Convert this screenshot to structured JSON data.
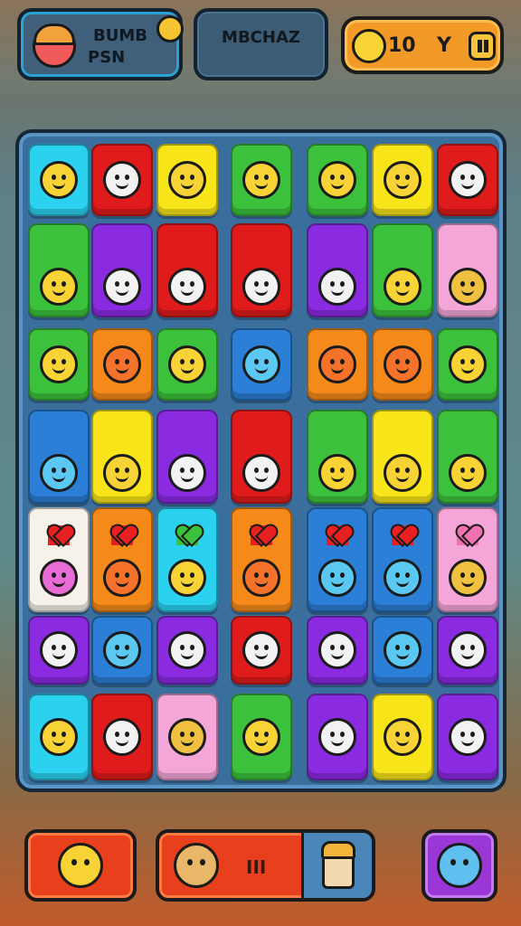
{
  "hud": {
    "player_name_line1": "BUMB",
    "player_name_line2": "PSN",
    "level_label": "MBCHAZ",
    "coin_value": "10",
    "coin_suffix": "Y",
    "pause_icon": "pause-icon"
  },
  "board": {
    "rows": 7,
    "cols": 7,
    "tiles": [
      [
        "cyan",
        "red",
        "yellow",
        "green",
        "green",
        "yellow",
        "red"
      ],
      [
        "green",
        "purple",
        "red",
        "red",
        "purple",
        "green",
        "pink"
      ],
      [
        "green",
        "orange",
        "green",
        "blue",
        "orange",
        "orange",
        "green"
      ],
      [
        "blue",
        "yellow",
        "purple",
        "red",
        "green",
        "yellow",
        "green"
      ],
      [
        "white",
        "orange",
        "cyan",
        "orange",
        "blue",
        "blue",
        "pink"
      ],
      [
        "purple",
        "blue",
        "purple",
        "red",
        "purple",
        "blue",
        "purple"
      ],
      [
        "cyan",
        "red",
        "pink",
        "green",
        "purple",
        "yellow",
        "purple"
      ]
    ]
  },
  "bottom": {
    "mid_label": "III",
    "left_icon": "sun-creature-icon",
    "mid_icon": "bear-face-icon",
    "lantern_icon": "lantern-icon",
    "right_icon": "hippo-face-icon"
  },
  "colors": {
    "cyan": "#2ad2f0",
    "red": "#e01b1b",
    "yellow": "#f7e51a",
    "green": "#3cc13c",
    "purple": "#8a2be2",
    "pink": "#f4a6d8",
    "orange": "#f58a1a",
    "blue": "#2b7fd6",
    "white": "#f6f2ea"
  }
}
